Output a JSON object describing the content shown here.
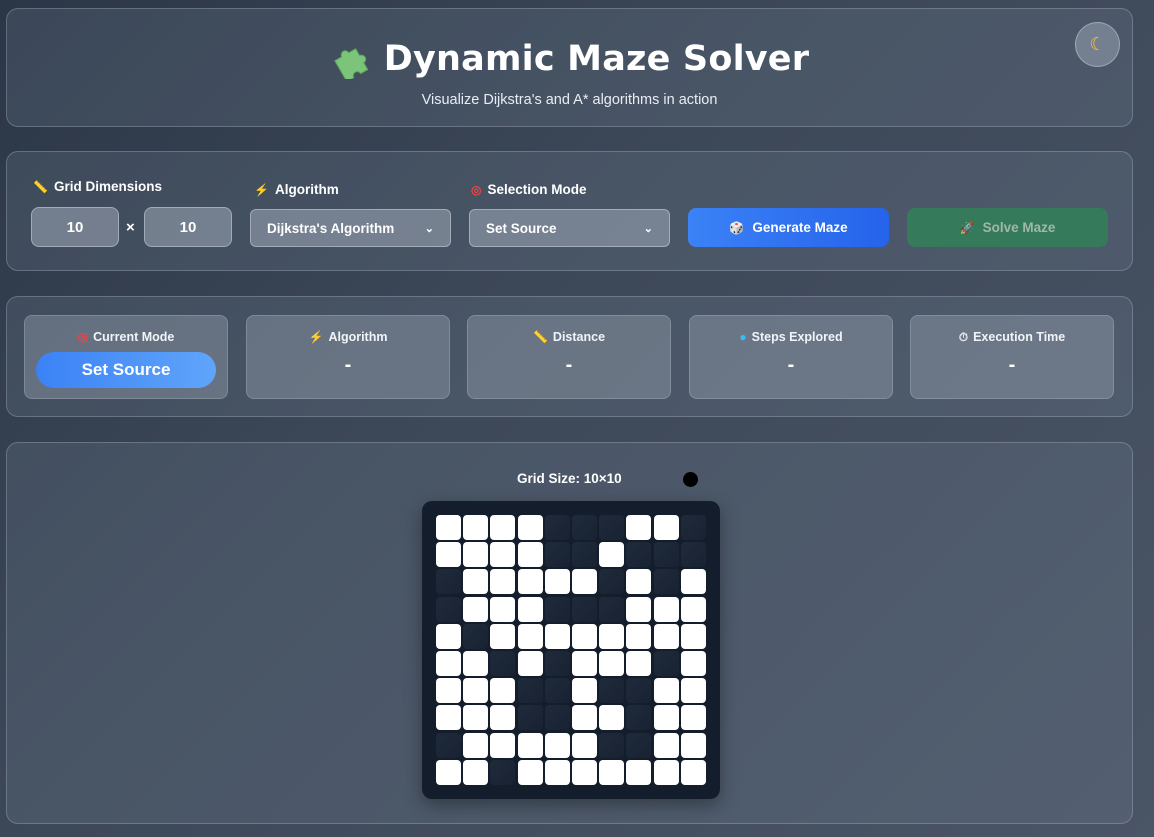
{
  "header": {
    "title": "Dynamic Maze Solver",
    "subtitle": "Visualize Dijkstra's and A* algorithms in action",
    "title_icon": "puzzle-piece-icon",
    "theme_toggle_icon": "moon-icon"
  },
  "controls": {
    "grid_dimensions_label": "Grid Dimensions",
    "rows": "10",
    "cols": "10",
    "times_sign": "×",
    "algorithm_label": "Algorithm",
    "algorithm_selected": "Dijkstra's Algorithm",
    "selection_mode_label": "Selection Mode",
    "selection_mode_selected": "Set Source",
    "generate_button": "Generate Maze",
    "solve_button": "Solve Maze"
  },
  "stats": {
    "current_mode_label": "Current Mode",
    "current_mode_value": "Set Source",
    "algorithm_label": "Algorithm",
    "algorithm_value": "-",
    "distance_label": "Distance",
    "distance_value": "-",
    "steps_label": "Steps Explored",
    "steps_value": "-",
    "time_label": "Execution Time",
    "time_value": "-"
  },
  "grid": {
    "size_label": "Grid Size: 10×10",
    "rows": 10,
    "cols": 10,
    "cells": [
      "1111000110",
      "1111001000",
      "0111110101",
      "0111000111",
      "1011111111",
      "1101011101",
      "1110010011",
      "1110011011",
      "0111110011",
      "1101111111"
    ]
  },
  "colors": {
    "accent_blue": "#3b82f6",
    "solve_green": "#357a5a",
    "open_cell": "#ffffff",
    "wall_cell": "#1f2a3a"
  }
}
